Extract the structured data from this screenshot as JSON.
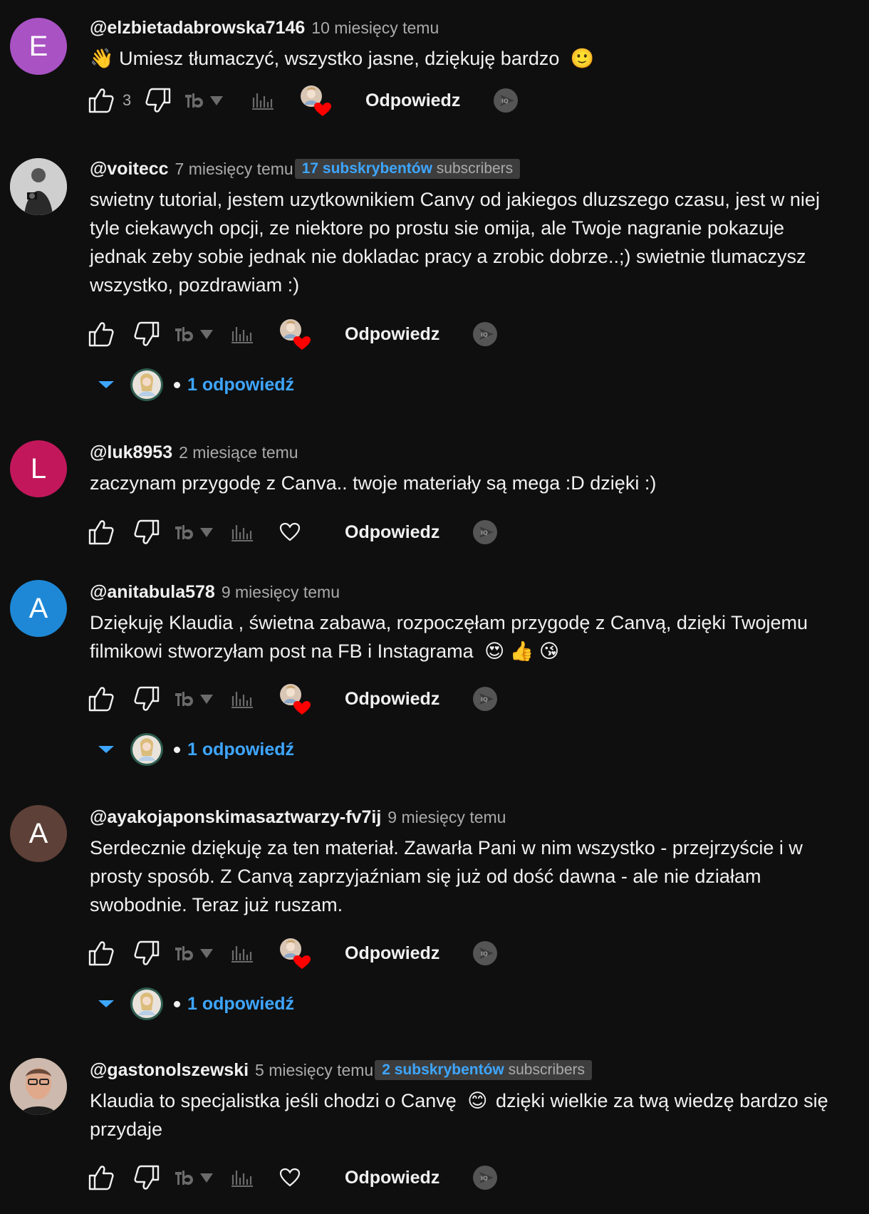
{
  "comments": [
    {
      "author": "@elzbietadabrowska7146",
      "time": "10 miesięcy temu",
      "avatar_letter": "E",
      "avatar_color": "#a952c4",
      "text_emoji": "👋",
      "text": "Umiesz tłumaczyć, wszystko jasne, dziękuję bardzo",
      "text_emoji_end": "🙂",
      "likes": "3",
      "reply_label": "Odpowiedz"
    },
    {
      "author": "@voitecc",
      "time": "7 miesięcy temu",
      "badge_count": "17 subskrybentów",
      "badge_suffix": "subscribers",
      "text": "swietny tutorial, jestem uzytkownikiem Canvy od jakiegos dluzszego czasu, jest w niej tyle ciekawych opcji, ze niektore po prostu sie omija, ale Twoje nagranie pokazuje jednak zeby sobie jednak nie dokladac pracy a zrobic dobrze..;) swietnie tlumaczysz wszystko, pozdrawiam :)",
      "reply_label": "Odpowiedz",
      "replies_label": "1 odpowiedź"
    },
    {
      "author": "@luk8953",
      "time": "2 miesiące temu",
      "avatar_letter": "L",
      "avatar_color": "#c2185b",
      "text": "zaczynam przygodę z Canva.. twoje materiały są mega :D dzięki :)",
      "reply_label": "Odpowiedz"
    },
    {
      "author": "@anitabula578",
      "time": "9 miesięcy temu",
      "avatar_letter": "A",
      "avatar_color": "#1e88d6",
      "text": "Dziękuję Klaudia , świetna zabawa, rozpoczęłam przygodę z  Canvą, dzięki Twojemu filmikowi stworzyłam post na FB i Instagrama",
      "text_emojis": "😍 👍 😘",
      "reply_label": "Odpowiedz",
      "replies_label": "1 odpowiedź"
    },
    {
      "author": "@ayakojaponskimasaztwarzy-fv7ij",
      "time": "9 miesięcy temu",
      "avatar_letter": "A",
      "avatar_color": "#5d4037",
      "text": "Serdecznie dziękuję za ten materiał. Zawarła Pani w nim wszystko - przejrzyście i w prosty sposób. Z Canvą zaprzyjaźniam się już od dość dawna - ale nie działam swobodnie. Teraz już ruszam.",
      "reply_label": "Odpowiedz",
      "replies_label": "1 odpowiedź"
    },
    {
      "author": "@gastonolszewski",
      "time": "5 miesięcy temu",
      "badge_count": "2 subskrybentów",
      "badge_suffix": "subscribers",
      "text_before": "Klaudia to specjalistka jeśli chodzi o Canvę",
      "text_emoji_mid": "😊",
      "text_after": "dzięki wielkie za twą wiedzę bardzo się przydaje",
      "reply_label": "Odpowiedz"
    }
  ],
  "colors": {
    "link": "#3ea6ff",
    "background": "#0f0f0f",
    "heart": "#ff0000"
  },
  "icons": [
    "thumbs-up-icon",
    "thumbs-down-icon",
    "tb-logo-icon",
    "caret-down-icon",
    "bar-chart-icon",
    "creator-heart-icon",
    "heart-outline-icon",
    "iq-badge-icon"
  ]
}
